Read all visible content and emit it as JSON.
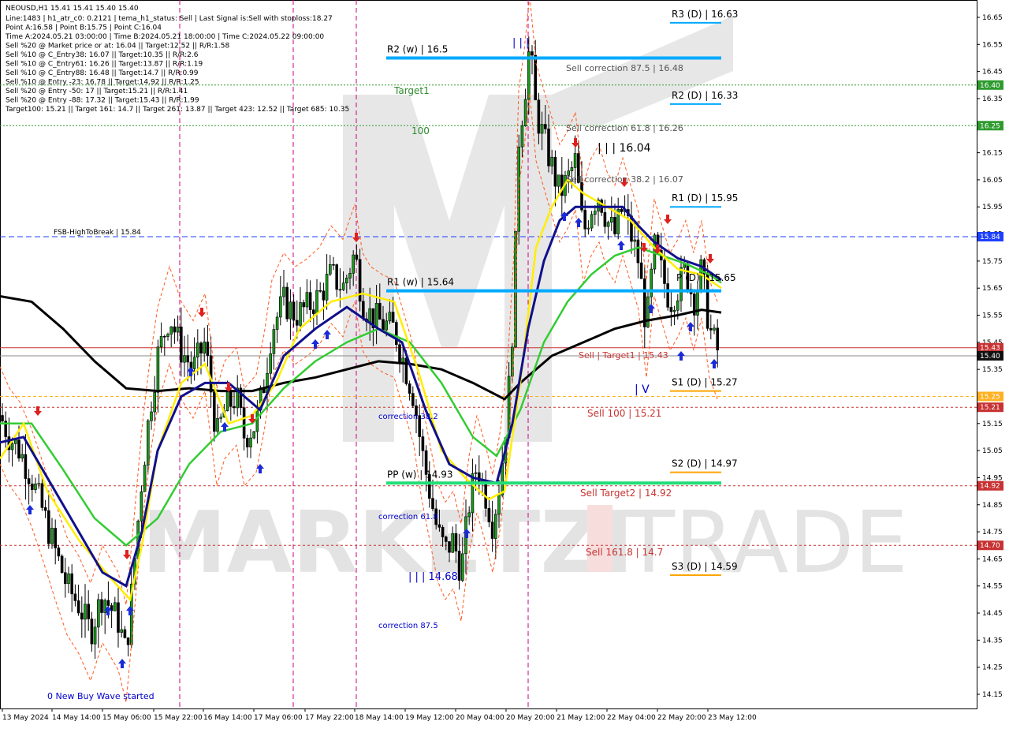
{
  "chart_data": {
    "type": "candlestick",
    "symbol_header": "NEOUSD,H1  15.41 15.41 15.40 15.40",
    "info_lines": [
      "Line:1483  |  h1_atr_c0: 0.2121  |  tema_h1_status: Sell  |  Last Signal is:Sell with stoploss:18.27",
      "Point A:16.58  |  Point B:15.75  |  Point C:16.04",
      "Time A:2024.05.21 03:00:00  |  Time B:2024.05.21 18:00:00  |  Time C:2024.05.22 09:00:00",
      "Sell %20 @ Market price or at: 16.04  ||  Target:12.52  ||  R/R:1.58",
      "Sell %10 @ C_Entry38: 16.07  ||  Target:10.35  ||  R/R:2.6",
      "Sell %10 @ C_Entry61: 16.26  ||  Target:13.87  ||  R/R:1.19",
      "Sell %10 @ C_Entry88: 16.48  ||  Target:14.7  ||  R/R:0.99",
      "Sell %10 @ Entry -23: 16.78  ||  Target:14.92  ||  R/R:1.25",
      "Sell %20 @ Entry -50: 17  ||  Target:15.21  ||  R/R:1.41",
      "Sell %20 @ Entry -88: 17.32  ||  Target:15.43  ||  R/R:1.99",
      "Target100: 15.21  ||  Target 161: 14.7  ||  Target 261: 13.87  ||  Target 423: 12.52  ||  Target 685: 10.35"
    ],
    "y_ticks": [
      "16.65",
      "16.55",
      "16.45",
      "16.35",
      "16.25",
      "16.15",
      "16.05",
      "15.95",
      "15.85",
      "15.75",
      "15.65",
      "15.55",
      "15.45",
      "15.35",
      "15.25",
      "15.15",
      "15.05",
      "14.95",
      "14.85",
      "14.75",
      "14.65",
      "14.55",
      "14.45",
      "14.35",
      "14.25",
      "14.15"
    ],
    "y_range": [
      14.125,
      16.72
    ],
    "x_labels": [
      "13 May 2024",
      "14 May 14:00",
      "15 May 06:00",
      "15 May 22:00",
      "16 May 14:00",
      "17 May 06:00",
      "17 May 22:00",
      "18 May 14:00",
      "19 May 12:00",
      "20 May 04:00",
      "20 May 20:00",
      "21 May 12:00",
      "22 May 04:00",
      "22 May 20:00",
      "23 May 12:00"
    ],
    "price_badges": [
      {
        "text": "15.84",
        "color": "#1e40ff",
        "price": 15.84
      },
      {
        "text": "16.40",
        "color": "#2e9b2e",
        "price": 16.4
      },
      {
        "text": "16.25",
        "color": "#2e9b2e",
        "price": 16.25
      },
      {
        "text": "15.43",
        "color": "#c83232",
        "price": 15.43
      },
      {
        "text": "15.40",
        "color": "#111111",
        "price": 15.4
      },
      {
        "text": "15.25",
        "color": "#ffb020",
        "price": 15.25
      },
      {
        "text": "15.21",
        "color": "#c83232",
        "price": 15.21
      },
      {
        "text": "14.92",
        "color": "#c83232",
        "price": 14.92
      },
      {
        "text": "14.70",
        "color": "#c83232",
        "price": 14.7
      }
    ],
    "levels": [
      {
        "label": "R3 (D) | 16.63",
        "price": 16.63,
        "color": "#00aaff"
      },
      {
        "label": "R2 (w) | 16.5",
        "price": 16.5,
        "color": "#00aaff"
      },
      {
        "label": "R2 (D) | 16.33",
        "price": 16.33,
        "color": "#00aaff"
      },
      {
        "label": "R1 (D) | 15.95",
        "price": 15.95,
        "color": "#00aaff"
      },
      {
        "label": "R1 (w) | 15.64",
        "price": 15.64,
        "color": "#00aaff"
      },
      {
        "label": "S1 (D) | 15.27",
        "price": 15.27,
        "color": "#ffa500"
      },
      {
        "label": "PP (w) | 14.93",
        "price": 14.93,
        "color": "#22dd77"
      },
      {
        "label": "S2 (D) | 14.97",
        "price": 14.97,
        "color": "#ffa500"
      },
      {
        "label": "S3 (D) | 14.59",
        "price": 14.59,
        "color": "#ffa500"
      }
    ],
    "annotations": [
      {
        "text": "FSB-HighToBreak  |  15.84",
        "color": "#000000"
      },
      {
        "text": "Target1",
        "color": "#2e8b2e"
      },
      {
        "text": "100",
        "color": "#2e8b2e"
      },
      {
        "text": "Sell correction 87.5 | 16.48",
        "color": "#555555"
      },
      {
        "text": "Sell correction 61.8 | 16.26",
        "color": "#555555"
      },
      {
        "text": "Sell correction 38.2 | 16.07",
        "color": "#555555"
      },
      {
        "text": "| | | 16.04",
        "color": "#000000"
      },
      {
        "text": "| | |",
        "color": "#0000cc"
      },
      {
        "text": "Sell | Target1 | 15.43",
        "color": "#c83232"
      },
      {
        "text": "Sell 100 | 15.21",
        "color": "#c83232"
      },
      {
        "text": "Sell Target2 | 14.92",
        "color": "#c83232"
      },
      {
        "text": "Sell 161.8 | 14.7",
        "color": "#c83232"
      },
      {
        "text": "| V",
        "color": "#0000cc"
      },
      {
        "text": "P (D) | 15.65",
        "color": "#000000"
      },
      {
        "text": "correction 38.2",
        "color": "#0000cc"
      },
      {
        "text": "correction 61.8",
        "color": "#0000cc"
      },
      {
        "text": "correction 87.5",
        "color": "#0000cc"
      },
      {
        "text": "| | | 14.68",
        "color": "#0000cc"
      },
      {
        "text": "0 New Buy Wave started",
        "color": "#0000cc"
      }
    ],
    "series_path": [
      [
        0,
        15.18
      ],
      [
        12,
        15.1
      ],
      [
        25,
        15.05
      ],
      [
        40,
        14.95
      ],
      [
        55,
        14.82
      ],
      [
        70,
        14.68
      ],
      [
        85,
        14.55
      ],
      [
        100,
        14.48
      ],
      [
        115,
        14.38
      ],
      [
        130,
        14.52
      ],
      [
        150,
        14.42
      ],
      [
        160,
        14.3
      ],
      [
        170,
        14.62
      ],
      [
        180,
        14.95
      ],
      [
        190,
        15.2
      ],
      [
        200,
        15.4
      ],
      [
        215,
        15.55
      ],
      [
        230,
        15.42
      ],
      [
        245,
        15.35
      ],
      [
        260,
        15.45
      ],
      [
        275,
        15.1
      ],
      [
        285,
        15.2
      ],
      [
        300,
        15.25
      ],
      [
        310,
        15.1
      ],
      [
        325,
        15.15
      ],
      [
        335,
        15.3
      ],
      [
        345,
        15.5
      ],
      [
        360,
        15.6
      ],
      [
        375,
        15.55
      ],
      [
        390,
        15.58
      ],
      [
        405,
        15.62
      ],
      [
        420,
        15.7
      ],
      [
        435,
        15.65
      ],
      [
        450,
        15.78
      ],
      [
        460,
        15.6
      ],
      [
        470,
        15.55
      ],
      [
        485,
        15.52
      ],
      [
        500,
        15.5
      ],
      [
        515,
        15.35
      ],
      [
        525,
        15.25
      ],
      [
        535,
        15.05
      ],
      [
        545,
        14.9
      ],
      [
        555,
        14.75
      ],
      [
        565,
        14.68
      ],
      [
        575,
        14.72
      ],
      [
        585,
        14.6
      ],
      [
        595,
        14.85
      ],
      [
        605,
        15.0
      ],
      [
        615,
        14.9
      ],
      [
        625,
        14.78
      ],
      [
        635,
        14.95
      ],
      [
        645,
        15.25
      ],
      [
        652,
        15.6
      ],
      [
        658,
        16.2
      ],
      [
        665,
        16.35
      ],
      [
        672,
        16.55
      ],
      [
        680,
        16.3
      ],
      [
        690,
        16.2
      ],
      [
        700,
        16.1
      ],
      [
        710,
        16.0
      ],
      [
        720,
        16.05
      ],
      [
        730,
        16.12
      ],
      [
        740,
        15.85
      ],
      [
        750,
        15.95
      ],
      [
        760,
        16.0
      ],
      [
        770,
        15.9
      ],
      [
        780,
        15.85
      ],
      [
        790,
        15.95
      ],
      [
        800,
        15.85
      ],
      [
        810,
        15.75
      ],
      [
        820,
        15.5
      ],
      [
        830,
        15.8
      ],
      [
        840,
        15.7
      ],
      [
        850,
        15.6
      ],
      [
        860,
        15.65
      ],
      [
        870,
        15.72
      ],
      [
        880,
        15.6
      ],
      [
        890,
        15.72
      ],
      [
        900,
        15.5
      ],
      [
        910,
        15.42
      ]
    ],
    "ema_black": [
      [
        0,
        15.62
      ],
      [
        40,
        15.6
      ],
      [
        80,
        15.5
      ],
      [
        120,
        15.38
      ],
      [
        160,
        15.28
      ],
      [
        200,
        15.27
      ],
      [
        240,
        15.28
      ],
      [
        280,
        15.27
      ],
      [
        320,
        15.27
      ],
      [
        360,
        15.3
      ],
      [
        400,
        15.32
      ],
      [
        440,
        15.35
      ],
      [
        480,
        15.38
      ],
      [
        520,
        15.37
      ],
      [
        560,
        15.35
      ],
      [
        600,
        15.3
      ],
      [
        640,
        15.24
      ],
      [
        660,
        15.3
      ],
      [
        700,
        15.4
      ],
      [
        740,
        15.45
      ],
      [
        780,
        15.5
      ],
      [
        820,
        15.53
      ],
      [
        860,
        15.55
      ],
      [
        890,
        15.57
      ],
      [
        915,
        15.56
      ]
    ],
    "ema_blue": [
      [
        0,
        15.08
      ],
      [
        30,
        15.1
      ],
      [
        60,
        14.95
      ],
      [
        100,
        14.75
      ],
      [
        130,
        14.6
      ],
      [
        160,
        14.55
      ],
      [
        180,
        14.75
      ],
      [
        200,
        15.05
      ],
      [
        230,
        15.25
      ],
      [
        260,
        15.3
      ],
      [
        290,
        15.3
      ],
      [
        330,
        15.2
      ],
      [
        360,
        15.4
      ],
      [
        400,
        15.5
      ],
      [
        440,
        15.58
      ],
      [
        480,
        15.5
      ],
      [
        510,
        15.45
      ],
      [
        540,
        15.2
      ],
      [
        570,
        15.0
      ],
      [
        600,
        14.95
      ],
      [
        630,
        14.93
      ],
      [
        650,
        15.15
      ],
      [
        670,
        15.5
      ],
      [
        690,
        15.75
      ],
      [
        710,
        15.9
      ],
      [
        730,
        15.95
      ],
      [
        760,
        15.95
      ],
      [
        790,
        15.95
      ],
      [
        810,
        15.88
      ],
      [
        830,
        15.82
      ],
      [
        860,
        15.76
      ],
      [
        890,
        15.73
      ],
      [
        915,
        15.68
      ]
    ],
    "ema_yellow": [
      [
        0,
        15.02
      ],
      [
        30,
        15.15
      ],
      [
        60,
        14.9
      ],
      [
        100,
        14.72
      ],
      [
        140,
        14.58
      ],
      [
        165,
        14.5
      ],
      [
        180,
        14.7
      ],
      [
        200,
        15.05
      ],
      [
        230,
        15.3
      ],
      [
        260,
        15.37
      ],
      [
        290,
        15.15
      ],
      [
        320,
        15.18
      ],
      [
        350,
        15.3
      ],
      [
        380,
        15.5
      ],
      [
        420,
        15.6
      ],
      [
        460,
        15.63
      ],
      [
        500,
        15.6
      ],
      [
        530,
        15.35
      ],
      [
        560,
        15.05
      ],
      [
        590,
        14.95
      ],
      [
        620,
        14.87
      ],
      [
        640,
        14.9
      ],
      [
        660,
        15.3
      ],
      [
        680,
        15.8
      ],
      [
        700,
        15.95
      ],
      [
        720,
        16.05
      ],
      [
        740,
        16.0
      ],
      [
        770,
        15.95
      ],
      [
        800,
        15.9
      ],
      [
        830,
        15.8
      ],
      [
        860,
        15.72
      ],
      [
        890,
        15.7
      ],
      [
        915,
        15.65
      ]
    ],
    "ema_green": [
      [
        0,
        15.15
      ],
      [
        40,
        15.15
      ],
      [
        80,
        14.98
      ],
      [
        120,
        14.8
      ],
      [
        160,
        14.7
      ],
      [
        200,
        14.8
      ],
      [
        240,
        15.0
      ],
      [
        280,
        15.12
      ],
      [
        320,
        15.15
      ],
      [
        360,
        15.28
      ],
      [
        400,
        15.38
      ],
      [
        440,
        15.45
      ],
      [
        480,
        15.5
      ],
      [
        520,
        15.45
      ],
      [
        560,
        15.3
      ],
      [
        600,
        15.1
      ],
      [
        630,
        15.03
      ],
      [
        660,
        15.2
      ],
      [
        690,
        15.45
      ],
      [
        720,
        15.6
      ],
      [
        750,
        15.7
      ],
      [
        780,
        15.77
      ],
      [
        810,
        15.8
      ],
      [
        840,
        15.77
      ],
      [
        870,
        15.74
      ],
      [
        900,
        15.7
      ],
      [
        915,
        15.67
      ]
    ]
  }
}
